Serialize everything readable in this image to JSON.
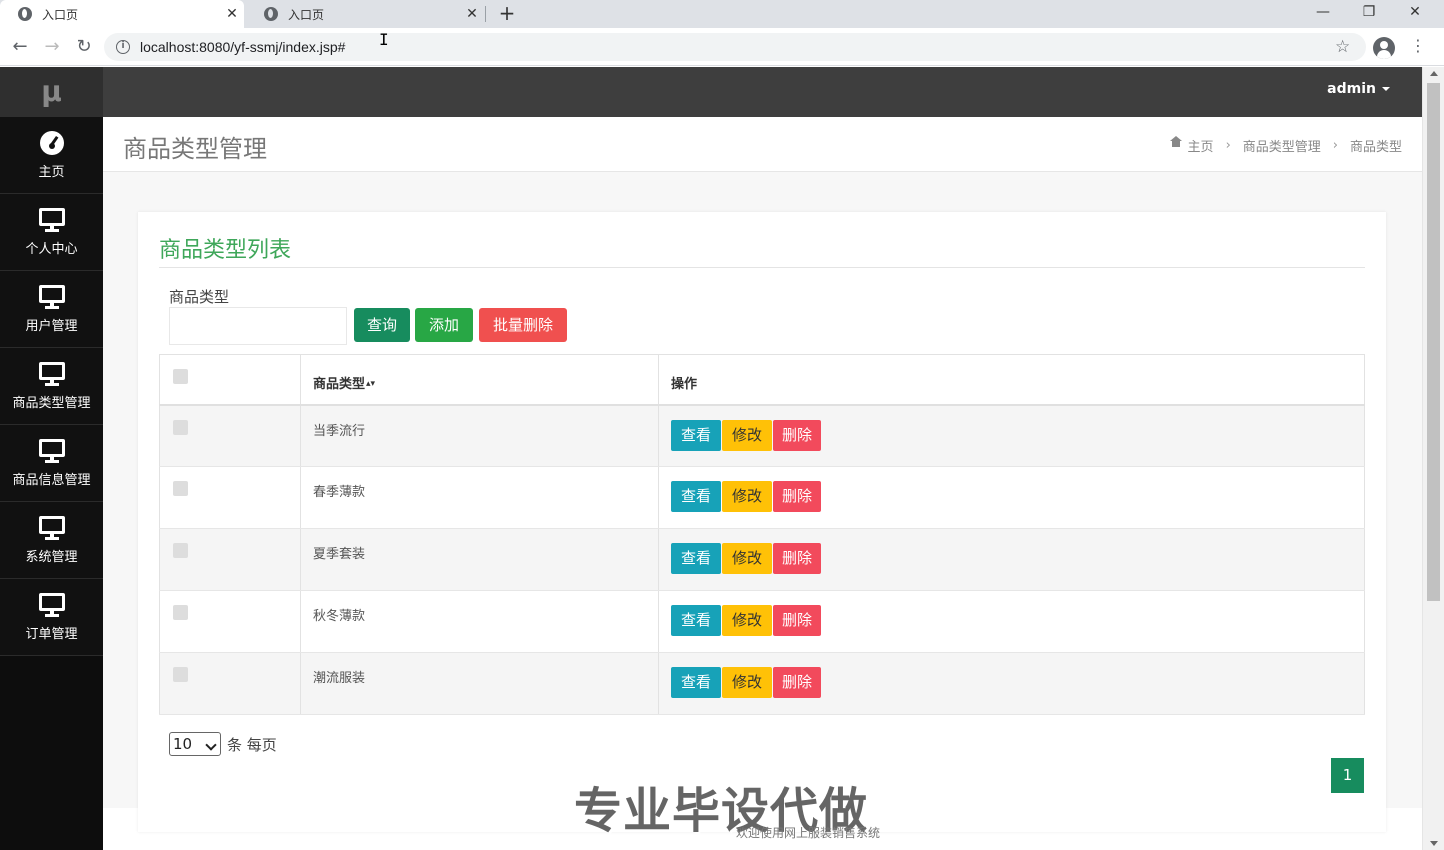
{
  "browser": {
    "tabs": [
      {
        "title": "入口页",
        "close": "✕"
      },
      {
        "title": "入口页",
        "close": "✕"
      }
    ],
    "new_tab": "+",
    "window_controls": {
      "minimize": "—",
      "restore": "❐",
      "close": "✕"
    },
    "nav": {
      "back": "←",
      "forward": "→",
      "reload": "↻"
    },
    "info": "i",
    "url": "localhost:8080/yf-ssmj/index.jsp#",
    "star": "☆",
    "menu": "⋮",
    "cursor": "I"
  },
  "sidebar": {
    "logo": "μ",
    "items": [
      {
        "label": "主页",
        "icon": "dashboard-icon"
      },
      {
        "label": "个人中心",
        "icon": "monitor-icon"
      },
      {
        "label": "用户管理",
        "icon": "monitor-icon"
      },
      {
        "label": "商品类型管理",
        "icon": "monitor-icon"
      },
      {
        "label": "商品信息管理",
        "icon": "monitor-icon"
      },
      {
        "label": "系统管理",
        "icon": "monitor-icon"
      },
      {
        "label": "订单管理",
        "icon": "monitor-icon"
      }
    ]
  },
  "topbar": {
    "user": "admin"
  },
  "header": {
    "title": "商品类型管理",
    "breadcrumb": [
      "主页",
      "商品类型管理",
      "商品类型"
    ],
    "breadcrumb_sep": "›"
  },
  "card": {
    "title": "商品类型列表",
    "search_label": "商品类型",
    "search_value": "",
    "buttons": {
      "query": "查询",
      "add": "添加",
      "batch_delete": "批量删除"
    }
  },
  "table": {
    "headers": {
      "name": "商品类型",
      "sort": "▴▾",
      "ops": "操作"
    },
    "rows": [
      {
        "name": "当季流行"
      },
      {
        "name": "春季薄款"
      },
      {
        "name": "夏季套装"
      },
      {
        "name": "秋冬薄款"
      },
      {
        "name": "潮流服装"
      }
    ],
    "row_actions": {
      "view": "查看",
      "edit": "修改",
      "delete": "删除"
    }
  },
  "pager": {
    "page_size": "10",
    "per_page_text": "条 每页",
    "current_page": "1"
  },
  "watermark": "专业毕设代做",
  "footer": "欢迎使用网上服装销售系统",
  "colors": {
    "accent": "#178c5e",
    "title_green": "#3fa75a",
    "sidebar": "#0d0d0d",
    "topbar": "#3e3e3e",
    "view": "#17a2b8",
    "edit": "#ffc107",
    "delete": "#f24a5c"
  }
}
